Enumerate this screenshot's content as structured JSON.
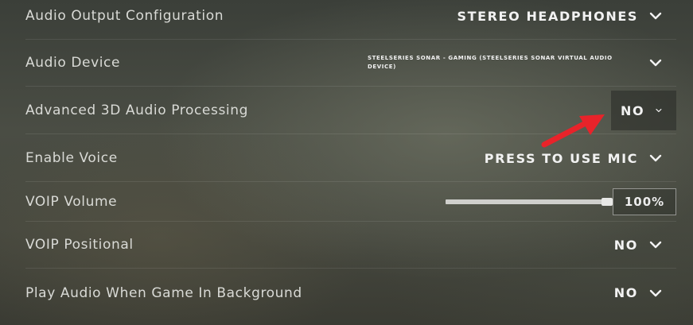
{
  "settings": [
    {
      "label": "Audio Output Configuration",
      "value": "STEREO HEADPHONES",
      "icon": "chevron-down-icon"
    },
    {
      "label": "Audio Device",
      "value": "STEELSERIES SONAR - GAMING (STEELSERIES SONAR VIRTUAL AUDIO DEVICE)",
      "icon": "chevron-down-icon"
    },
    {
      "label": "Advanced 3D Audio Processing",
      "value": "NO",
      "icon": "chevron-down-icon"
    },
    {
      "label": "Enable Voice",
      "value": "PRESS TO USE MIC",
      "icon": "chevron-down-icon"
    },
    {
      "label": "VOIP Volume",
      "value": "100%",
      "slider_percent": 100
    },
    {
      "label": "VOIP Positional",
      "value": "NO",
      "icon": "chevron-down-icon"
    },
    {
      "label": "Play Audio When Game In Background",
      "value": "NO",
      "icon": "chevron-down-icon"
    }
  ],
  "colors": {
    "annotation_arrow": "#e8232a",
    "text": "#d9dad6",
    "value_text": "#f2f2f2"
  }
}
